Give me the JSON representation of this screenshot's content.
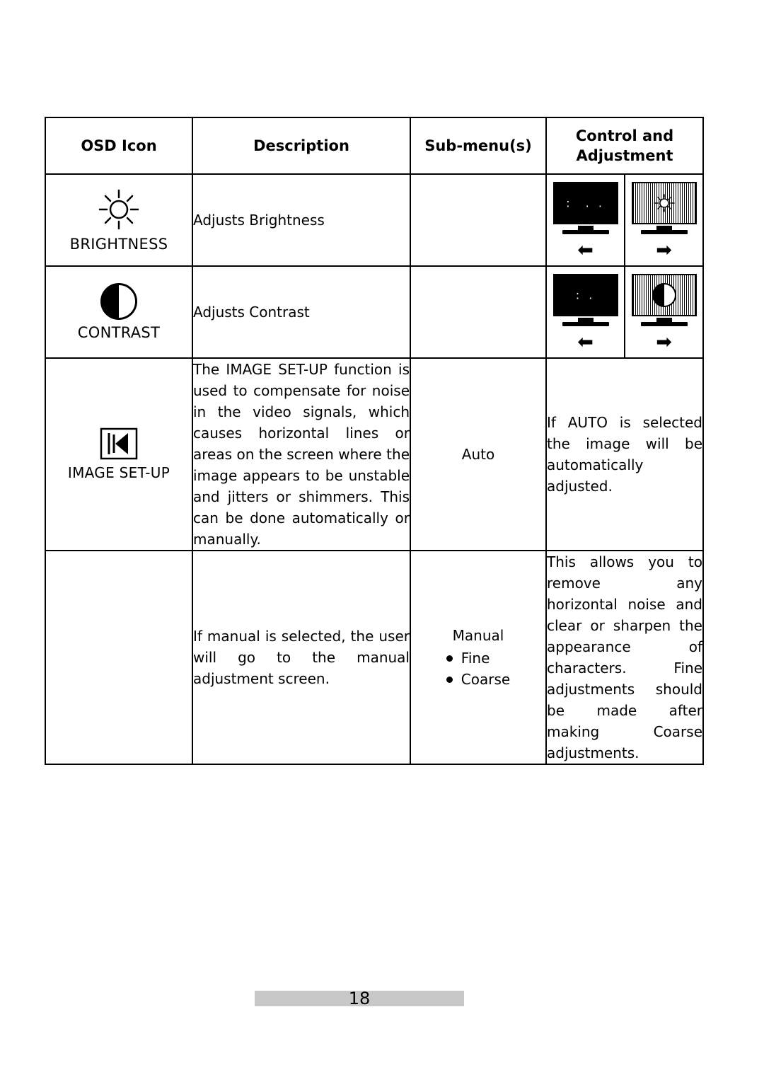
{
  "document": {
    "page_number": "18"
  },
  "table": {
    "headers": {
      "col1": "OSD Icon",
      "col2": "Description",
      "col3": "Sub-menu(s)",
      "col4_line1": "Control and",
      "col4_line2": "Adjustment"
    },
    "rows": [
      {
        "icon_name": "brightness-sun-icon",
        "icon_label": "BRIGHTNESS",
        "description": "Adjusts Brightness",
        "submenu": "",
        "control": "",
        "graphics": {
          "left_arrow": "⬅",
          "right_arrow": "➡"
        }
      },
      {
        "icon_name": "contrast-circle-icon",
        "icon_label": "CONTRAST",
        "description": "Adjusts Contrast",
        "submenu": "",
        "control": "",
        "graphics": {
          "left_arrow": "⬅",
          "right_arrow": "➡"
        }
      },
      {
        "icon_name": "image-setup-icon",
        "icon_label": "IMAGE SET-UP",
        "description": "The IMAGE SET-UP function is used to compensate for noise in the video signals, which causes horizontal lines or areas on the screen where the image appears to be unstable and jitters or shimmers. This can be done automatically or manually.",
        "submenu": "Auto",
        "control": "If AUTO is selected the image will be automatically adjusted."
      },
      {
        "icon_name": "",
        "icon_label": "",
        "description": "If manual is selected, the user will go to the manual adjustment screen.",
        "submenu": "Manual",
        "submenu_items": [
          "Fine",
          "Coarse"
        ],
        "control": "This allows you to remove any horizontal noise and clear or sharpen the appearance of characters. Fine adjustments should be made after making Coarse adjustments."
      }
    ]
  }
}
